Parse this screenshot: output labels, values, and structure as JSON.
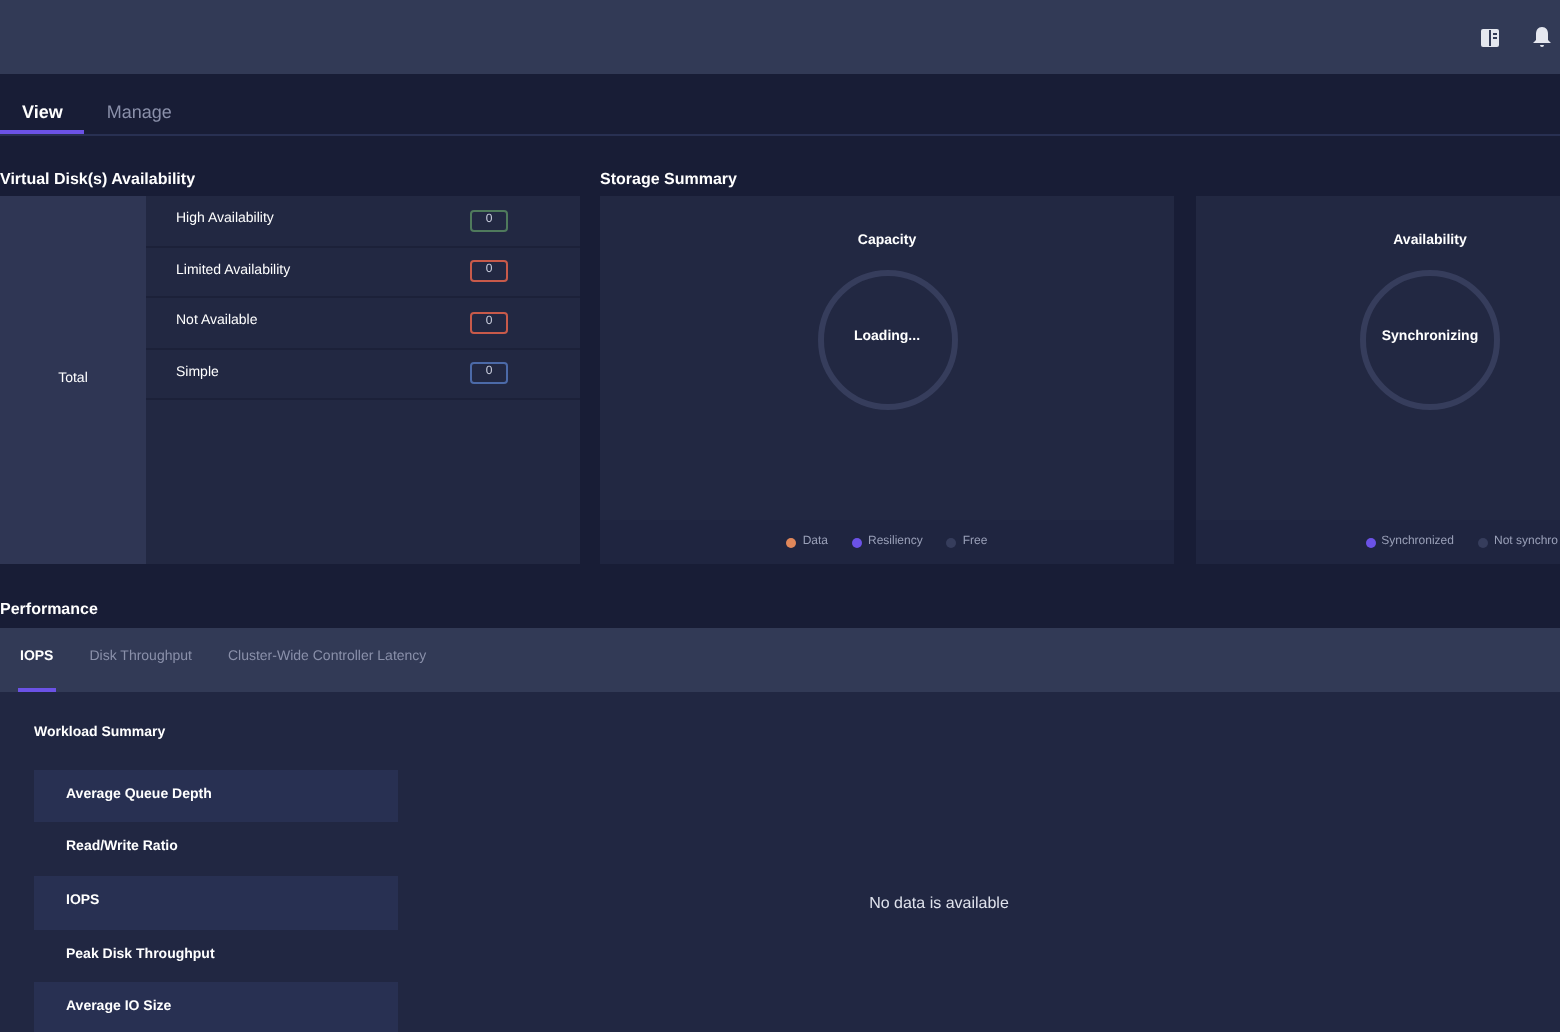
{
  "tabs": [
    {
      "label": "View",
      "selected": true
    },
    {
      "label": "Manage",
      "selected": false
    }
  ],
  "virtual_disk_availability": {
    "title": "Virtual Disk(s) Availability",
    "total_label": "Total",
    "rows": [
      {
        "label": "High Availability",
        "count": "0",
        "color": "#4f7a5c"
      },
      {
        "label": "Limited Availability",
        "count": "0",
        "color": "#c85a4a"
      },
      {
        "label": "Not Available",
        "count": "0",
        "color": "#c85a4a"
      },
      {
        "label": "Simple",
        "count": "0",
        "color": "#4c6aa8"
      }
    ]
  },
  "storage_summary": {
    "title": "Storage Summary",
    "panels": [
      {
        "title": "Capacity",
        "status": "Loading...",
        "legend": [
          {
            "label": "Data",
            "color": "#e0875a"
          },
          {
            "label": "Resiliency",
            "color": "#6b52e6"
          },
          {
            "label": "Free",
            "color": "#363d5c"
          }
        ]
      },
      {
        "title": "Availability",
        "status": "Synchronizing",
        "legend": [
          {
            "label": "Synchronized",
            "color": "#6b52e6"
          },
          {
            "label": "Not synchro",
            "color": "#363d5c"
          }
        ]
      }
    ]
  },
  "performance": {
    "title": "Performance",
    "tabs": [
      {
        "label": "IOPS",
        "selected": true
      },
      {
        "label": "Disk Throughput",
        "selected": false
      },
      {
        "label": "Cluster-Wide Controller Latency",
        "selected": false
      }
    ],
    "workload_summary": {
      "title": "Workload Summary",
      "rows": [
        "Average Queue Depth",
        "Read/Write Ratio",
        "IOPS",
        "Peak Disk Throughput",
        "Average IO Size"
      ]
    },
    "empty_message": "No data is available"
  }
}
